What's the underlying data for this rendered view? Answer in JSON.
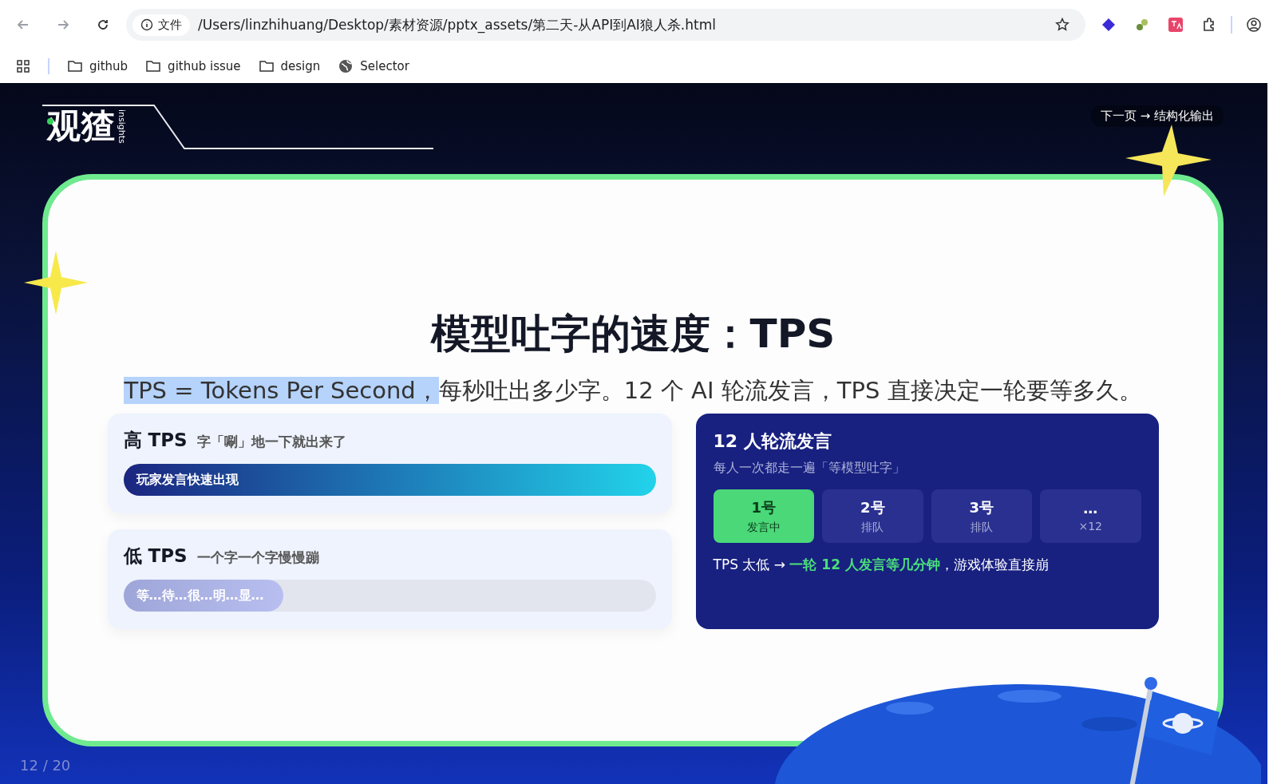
{
  "browser": {
    "site_info": "文件",
    "url": "/Users/linzhihuang/Desktop/素材资源/pptx_assets/第二天-从API到AI狼人杀.html",
    "bookmarks": [
      {
        "label": "github",
        "kind": "folder"
      },
      {
        "label": "github issue",
        "kind": "folder"
      },
      {
        "label": "design",
        "kind": "folder"
      },
      {
        "label": "Selector",
        "kind": "site"
      }
    ]
  },
  "slide": {
    "logo": {
      "name": "观猹",
      "tagline": "insights"
    },
    "next_link": "下一页 → 结构化输出",
    "title": "模型吐字的速度：TPS",
    "subtitle": {
      "highlighted": "TPS = Tokens Per Second，",
      "rest": "每秒吐出多少字。12 个 AI 轮流发言，TPS 直接决定一轮要等多久。"
    },
    "compare": [
      {
        "heading": "高 TPS",
        "note": "字「唰」地一下就出来了",
        "bar_text": "玩家发言快速出现",
        "level": 1,
        "kind": "fast"
      },
      {
        "heading": "低 TPS",
        "note": "一个字一个字慢慢蹦",
        "bar_text": "等…待…很…明…显…",
        "level": 0.3,
        "kind": "slow"
      }
    ],
    "turns": {
      "title": "12 人轮流发言",
      "subtitle": "每人一次都走一遍「等模型吐字」",
      "speakers": [
        {
          "label": "1号",
          "status": "发言中",
          "selected": true
        },
        {
          "label": "2号",
          "status": "排队",
          "selected": false
        },
        {
          "label": "3号",
          "status": "排队",
          "selected": false
        },
        {
          "label": "…",
          "status": "×12",
          "selected": false
        }
      ],
      "note": "TPS 太低 → **一轮 12 人发言等几分钟**，游戏体验直接崩"
    },
    "page": "12 / 20"
  }
}
